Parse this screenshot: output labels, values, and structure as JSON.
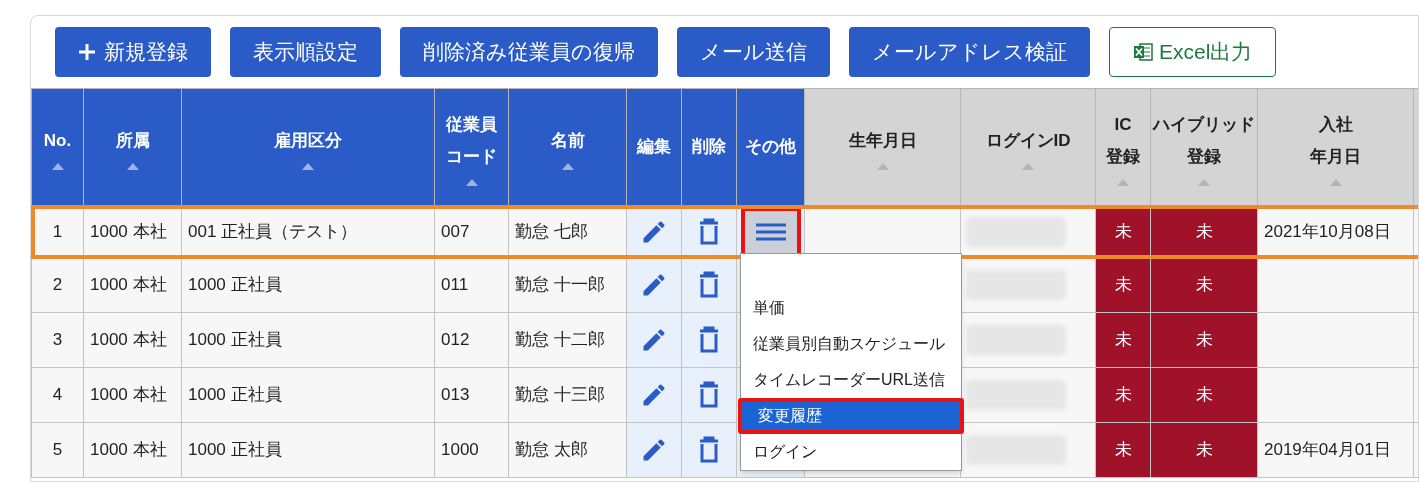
{
  "toolbar": [
    {
      "kind": "add",
      "label": "新規登録"
    },
    {
      "kind": "plain",
      "label": "表示順設定"
    },
    {
      "kind": "plain",
      "label": "削除済み従業員の復帰"
    },
    {
      "kind": "plain",
      "label": "メール送信"
    },
    {
      "kind": "plain",
      "label": "メールアドレス検証"
    },
    {
      "kind": "excel",
      "label": "Excel出力"
    }
  ],
  "table": {
    "columns": [
      {
        "lines": [
          "No."
        ],
        "fixed": true,
        "kind": "text"
      },
      {
        "lines": [
          "所属"
        ],
        "fixed": true,
        "kind": "text"
      },
      {
        "lines": [
          "雇用区分"
        ],
        "fixed": true,
        "kind": "text"
      },
      {
        "lines": [
          "従業員",
          "コード"
        ],
        "fixed": true,
        "kind": "text"
      },
      {
        "lines": [
          "名前"
        ],
        "fixed": true,
        "kind": "text"
      },
      {
        "lines": [
          "編集"
        ],
        "fixed": true,
        "kind": "edit"
      },
      {
        "lines": [
          "削除"
        ],
        "fixed": true,
        "kind": "delete"
      },
      {
        "lines": [
          "その他"
        ],
        "fixed": true,
        "kind": "menu"
      },
      {
        "lines": [
          "生年月日"
        ],
        "fixed": false,
        "kind": "text"
      },
      {
        "lines": [
          "ログインID"
        ],
        "fixed": false,
        "kind": "redacted"
      },
      {
        "lines": [
          "IC",
          "登録"
        ],
        "fixed": false,
        "kind": "status"
      },
      {
        "lines": [
          "ハイブリッド",
          "登録"
        ],
        "fixed": false,
        "kind": "status"
      },
      {
        "lines": [
          "入社",
          "年月日"
        ],
        "fixed": false,
        "kind": "text"
      }
    ],
    "rows": [
      {
        "selected": true,
        "cells": [
          "1",
          "1000 本社",
          "001 正社員（テスト）",
          "007",
          "勤怠 七郎",
          null,
          null,
          null,
          null,
          null,
          "未",
          "未",
          "2021年10月08日"
        ]
      },
      {
        "selected": false,
        "cells": [
          "2",
          "1000 本社",
          "1000 正社員",
          "011",
          "勤怠 十一郎",
          null,
          null,
          null,
          null,
          null,
          "未",
          "未",
          null
        ]
      },
      {
        "selected": false,
        "cells": [
          "3",
          "1000 本社",
          "1000 正社員",
          "012",
          "勤怠 十二郎",
          null,
          null,
          null,
          null,
          null,
          "未",
          "未",
          null
        ]
      },
      {
        "selected": false,
        "cells": [
          "4",
          "1000 本社",
          "1000 正社員",
          "013",
          "勤怠 十三郎",
          null,
          null,
          null,
          null,
          null,
          "未",
          "未",
          null
        ]
      },
      {
        "selected": false,
        "cells": [
          "5",
          "1000 本社",
          "1000 正社員",
          "1000",
          "勤怠 太郎",
          null,
          null,
          null,
          null,
          null,
          "未",
          "未",
          "2019年04月01日"
        ]
      }
    ]
  },
  "menu": {
    "open": true,
    "items": [
      {
        "label": "単価",
        "selected": false
      },
      {
        "label": "従業員別自動スケジュール",
        "selected": false
      },
      {
        "label": "タイムレコーダーURL送信",
        "selected": false
      },
      {
        "label": "変更履歴",
        "selected": true
      },
      {
        "label": "ログイン",
        "selected": false
      }
    ]
  }
}
